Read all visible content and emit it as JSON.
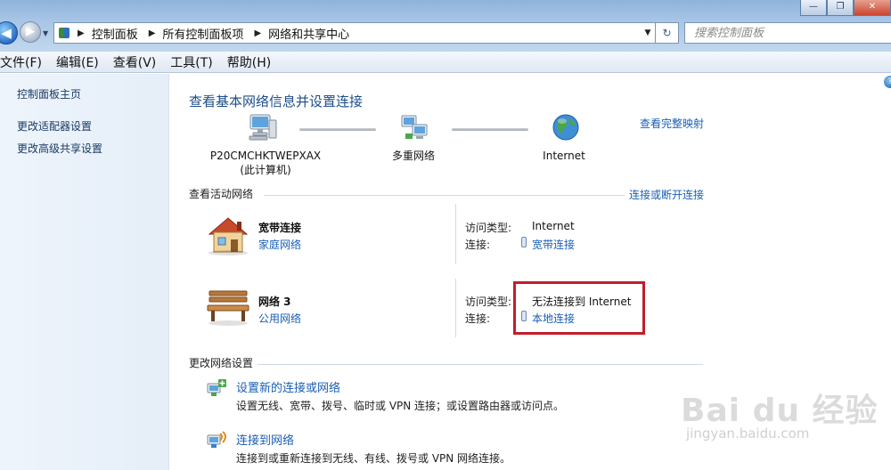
{
  "window": {
    "controls": [
      "—",
      "❐",
      "✕"
    ]
  },
  "address_bar": {
    "crumbs": [
      "控制面板",
      "所有控制面板项",
      "网络和共享中心"
    ],
    "search_placeholder": "搜索控制面板"
  },
  "menu": [
    "文件(F)",
    "编辑(E)",
    "查看(V)",
    "工具(T)",
    "帮助(H)"
  ],
  "sidebar": {
    "items": [
      "控制面板主页",
      "更改适配器设置",
      "更改高级共享设置"
    ]
  },
  "main": {
    "title": "查看基本网络信息并设置连接",
    "full_map_link": "查看完整映射",
    "map": {
      "computer_name": "P20CMCHKTWEPXAX",
      "computer_note": "(此计算机)",
      "middle": "多重网络",
      "internet": "Internet"
    },
    "active_section": "查看活动网络",
    "connect_link": "连接或断开连接",
    "networks": [
      {
        "name": "宽带连接",
        "type": "家庭网络",
        "access_label": "访问类型:",
        "access_value": "Internet",
        "conn_label": "连接:",
        "conn_value": "宽带连接",
        "icon": "house-icon"
      },
      {
        "name": "网络  3",
        "type": "公用网络",
        "access_label": "访问类型:",
        "access_value": "无法连接到 Internet",
        "conn_label": "连接:",
        "conn_value": "本地连接",
        "icon": "bench-icon"
      }
    ],
    "change_section": "更改网络设置",
    "tasks": [
      {
        "title": "设置新的连接或网络",
        "desc": "设置无线、宽带、拨号、临时或 VPN 连接；或设置路由器或访问点。"
      },
      {
        "title": "连接到网络",
        "desc": "连接到或重新连接到无线、有线、拨号或 VPN 网络连接。"
      }
    ]
  },
  "watermark": {
    "logo": "Bai du 经验",
    "url": "jingyan.baidu.com"
  },
  "colors": {
    "link": "#1a5fb4",
    "title": "#1e4d8a",
    "highlight": "#c21d2a"
  }
}
